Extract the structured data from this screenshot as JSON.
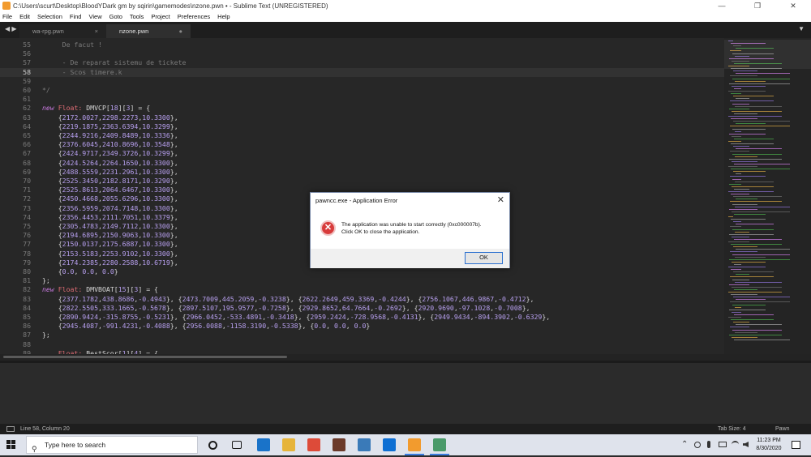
{
  "window": {
    "title": "C:\\Users\\scurt\\Desktop\\BloodYDark gm by sqirin\\gamemodes\\nzone.pwn • - Sublime Text (UNREGISTERED)",
    "minimize": "—",
    "maximize": "❐",
    "close": "✕"
  },
  "menu": [
    "File",
    "Edit",
    "Selection",
    "Find",
    "View",
    "Goto",
    "Tools",
    "Project",
    "Preferences",
    "Help"
  ],
  "tabs": {
    "nav_arrows": "◀ ▶",
    "dropdown": "▼",
    "items": [
      {
        "label": "wa-rpg.pwn",
        "close": "×"
      },
      {
        "label": "nzone.pwn",
        "close": "●"
      }
    ]
  },
  "editor": {
    "active_line": 58,
    "lines": [
      {
        "n": "55",
        "code": "     De facut !"
      },
      {
        "n": "56",
        "code": ""
      },
      {
        "n": "57",
        "code": "     - De reparat sistemu de tickete"
      },
      {
        "n": "58",
        "code": "     - Scos timere.k"
      },
      {
        "n": "59",
        "code": ""
      },
      {
        "n": "60",
        "code": "*/"
      },
      {
        "n": "61",
        "code": ""
      },
      {
        "n": "62",
        "code": "new Float: DMVCP[18][3] = {"
      },
      {
        "n": "63",
        "code": "    {2172.0027,2298.2273,10.3300},"
      },
      {
        "n": "64",
        "code": "    {2219.1875,2363.6394,10.3299},"
      },
      {
        "n": "65",
        "code": "    {2244.9216,2409.8489,10.3336},"
      },
      {
        "n": "66",
        "code": "    {2376.6045,2410.8696,10.3548},"
      },
      {
        "n": "67",
        "code": "    {2424.9717,2349.3726,10.3299},"
      },
      {
        "n": "68",
        "code": "    {2424.5264,2264.1650,10.3300},"
      },
      {
        "n": "69",
        "code": "    {2488.5559,2231.2961,10.3300},"
      },
      {
        "n": "70",
        "code": "    {2525.3450,2182.8171,10.3290},"
      },
      {
        "n": "71",
        "code": "    {2525.8613,2064.6467,10.3300},"
      },
      {
        "n": "72",
        "code": "    {2450.4668,2055.6296,10.3300},"
      },
      {
        "n": "73",
        "code": "    {2356.5959,2074.7148,10.3300},"
      },
      {
        "n": "74",
        "code": "    {2356.4453,2111.7051,10.3379},"
      },
      {
        "n": "75",
        "code": "    {2305.4783,2149.7112,10.3300},"
      },
      {
        "n": "76",
        "code": "    {2194.6895,2150.9063,10.3300},"
      },
      {
        "n": "77",
        "code": "    {2150.0137,2175.6887,10.3300},"
      },
      {
        "n": "78",
        "code": "    {2153.5183,2253.9102,10.3300},"
      },
      {
        "n": "79",
        "code": "    {2174.2385,2280.2588,10.6719},"
      },
      {
        "n": "80",
        "code": "    {0.0, 0.0, 0.0}"
      },
      {
        "n": "81",
        "code": "};"
      },
      {
        "n": "82",
        "code": "new Float: DMVBOAT[15][3] = {"
      },
      {
        "n": "83",
        "code": "    {2377.1782,438.8686,-0.4943}, {2473.7009,445.2059,-0.3238}, {2622.2649,459.3369,-0.4244}, {2756.1067,446.9867,-0.4712},"
      },
      {
        "n": "84",
        "code": "    {2822.5505,333.1665,-0.5678}, {2897.5107,195.9577,-0.7258}, {2929.8652,64.7664,-0.2692}, {2920.9690,-97.1028,-0.7008},"
      },
      {
        "n": "85",
        "code": "    {2890.9424,-315.8755,-0.5231}, {2966.0452,-533.4891,-0.3418}, {2959.2424,-728.9568,-0.4131}, {2949.9434,-894.3902,-0.6329},"
      },
      {
        "n": "86",
        "code": "    {2945.4087,-991.4231,-0.4088}, {2956.0088,-1158.3190,-0.5338}, {0.0, 0.0, 0.0}"
      },
      {
        "n": "87",
        "code": "};"
      },
      {
        "n": "88",
        "code": ""
      },
      {
        "n": "89",
        "code": "    Float: BestScor[1][4] = {"
      }
    ]
  },
  "status": {
    "position": "Line 58, Column 20",
    "tab_size": "Tab Size: 4",
    "syntax": "Pawn"
  },
  "dialog": {
    "title": "pawncc.exe - Application Error",
    "close": "✕",
    "icon": "✕",
    "message_line1": "The application was unable to start correctly (0xc000007b).",
    "message_line2": "Click OK to close the application.",
    "ok_label": "OK"
  },
  "taskbar": {
    "search_placeholder": "Type here to search",
    "search_icon": "⚲",
    "tray_up": "⌃",
    "time": "11:23 PM",
    "date": "8/30/2020",
    "apps": [
      {
        "name": "cortana-icon",
        "color": "#1b1b1b"
      },
      {
        "name": "task-view-icon",
        "color": "#1b1b1b"
      },
      {
        "name": "photos-icon",
        "color": "#1a73c9"
      },
      {
        "name": "file-explorer-icon",
        "color": "#e6b43a"
      },
      {
        "name": "chrome-icon",
        "color": "#dd4b39"
      },
      {
        "name": "game-icon",
        "color": "#6b3a2a"
      },
      {
        "name": "network-app-icon",
        "color": "#3a7ab8"
      },
      {
        "name": "teamviewer-icon",
        "color": "#0e6fd3"
      },
      {
        "name": "sublime-text-icon",
        "color": "#f29b2e"
      },
      {
        "name": "app-window-icon",
        "color": "#4a9a6a"
      }
    ]
  },
  "colors": {
    "editor_bg": "#272727",
    "keyword": "#c678dd",
    "type": "#e06c75",
    "number": "#b8a0f0",
    "comment": "#7a7a7a",
    "error_red": "#d83b3b",
    "accent_blue": "#2a6fcf"
  }
}
